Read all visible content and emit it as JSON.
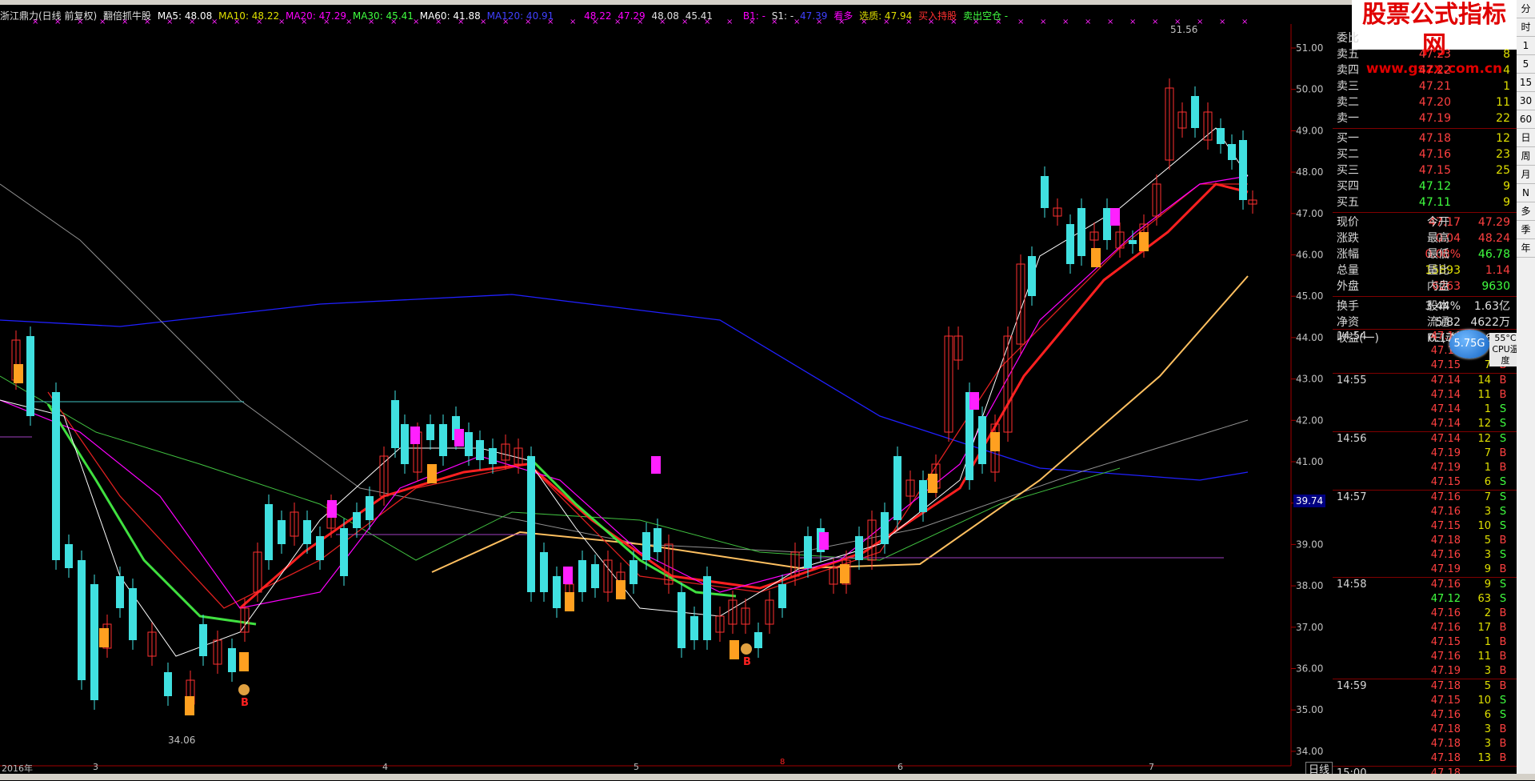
{
  "legend": {
    "title": "浙江鼎力(日线 前复权)",
    "formula": "翻倍抓牛股",
    "ma5": "MA5: 48.08",
    "ma10": "MA10: 48.22",
    "ma20": "MA20: 47.29",
    "ma30": "MA30: 45.41",
    "ma60": "MA60: 41.88",
    "ma120": "MA120: 40.91",
    "v1": "48.22",
    "v2": "47.29",
    "v3": "48.08",
    "v4": "45.41",
    "b1": "B1: -",
    "s1": "S1: -",
    "s1val": "47.39",
    "duo": "看多",
    "xuanq": "选质: 47.94",
    "buy": "买入持股",
    "sell": "卖出空仓 -"
  },
  "axis": {
    "labels": [
      "51.00",
      "50.00",
      "49.00",
      "48.00",
      "47.00",
      "46.00",
      "45.00",
      "44.00",
      "43.00",
      "42.00",
      "41.00",
      "40.00",
      "39.00",
      "38.00",
      "37.00",
      "36.00",
      "35.00",
      "34.00"
    ],
    "current": "39.74",
    "high": "51.56",
    "low": "34.06",
    "months": [
      "2016年",
      "3",
      "4",
      "5",
      "6",
      "7"
    ],
    "b_label": "B",
    "period": "日线"
  },
  "order_book": {
    "header": "委比",
    "asks": [
      {
        "label": "卖五",
        "price": "47.23",
        "vol": "8"
      },
      {
        "label": "卖四",
        "price": "47.22",
        "vol": "4"
      },
      {
        "label": "卖三",
        "price": "47.21",
        "vol": "1"
      },
      {
        "label": "卖二",
        "price": "47.20",
        "vol": "11"
      },
      {
        "label": "卖一",
        "price": "47.19",
        "vol": "22"
      }
    ],
    "bids": [
      {
        "label": "买一",
        "price": "47.18",
        "vol": "12"
      },
      {
        "label": "买二",
        "price": "47.16",
        "vol": "23"
      },
      {
        "label": "买三",
        "price": "47.15",
        "vol": "25"
      },
      {
        "label": "买四",
        "price": "47.12",
        "vol": "9"
      },
      {
        "label": "买五",
        "price": "47.11",
        "vol": "9"
      }
    ]
  },
  "quote": [
    {
      "k1": "现价",
      "v1": "47.17",
      "c1": "#ff4040",
      "k2": "今开",
      "v2": "47.29",
      "c2": "#ff4040"
    },
    {
      "k1": "涨跌",
      "v1": "0.04",
      "c1": "#ff4040",
      "k2": "最高",
      "v2": "48.24",
      "c2": "#ff4040"
    },
    {
      "k1": "涨幅",
      "v1": "0.08%",
      "c1": "#ff4040",
      "k2": "最低",
      "v2": "46.78",
      "c2": "#40ff40"
    },
    {
      "k1": "总量",
      "v1": "15893",
      "c1": "#e0e000",
      "k2": "量比",
      "v2": "1.14",
      "c2": "#ff4040"
    },
    {
      "k1": "外盘",
      "v1": "6263",
      "c1": "#ff4040",
      "k2": "内盘",
      "v2": "9630",
      "c2": "#40ff40"
    },
    {
      "k1": "换手",
      "v1": "3.44%",
      "c1": "#e0e0e0",
      "k2": "股本",
      "v2": "1.63亿",
      "c2": "#e0e0e0"
    },
    {
      "k1": "净资",
      "v1": "5.82",
      "c1": "#e0e0e0",
      "k2": "流通",
      "v2": "4622万",
      "c2": "#e0e0e0"
    },
    {
      "k1": "收益(一)",
      "v1": "0.177",
      "c1": "#e0e0e0",
      "k2": "PE(动)",
      "v2": "66.5",
      "c2": "#e0e0e0"
    }
  ],
  "ticks": [
    {
      "t": "14:54",
      "p": "47.14",
      "v": "",
      "d": ""
    },
    {
      "t": "",
      "p": "47.14",
      "v": "",
      "d": ""
    },
    {
      "t": "",
      "p": "47.15",
      "v": "7",
      "d": "B"
    },
    {
      "t": "14:55",
      "p": "47.14",
      "v": "14",
      "d": "B"
    },
    {
      "t": "",
      "p": "47.14",
      "v": "11",
      "d": "B"
    },
    {
      "t": "",
      "p": "47.14",
      "v": "1",
      "d": "S"
    },
    {
      "t": "",
      "p": "47.14",
      "v": "12",
      "d": "S"
    },
    {
      "t": "14:56",
      "p": "47.14",
      "v": "12",
      "d": "S"
    },
    {
      "t": "",
      "p": "47.19",
      "v": "7",
      "d": "B"
    },
    {
      "t": "",
      "p": "47.19",
      "v": "1",
      "d": "B"
    },
    {
      "t": "",
      "p": "47.15",
      "v": "6",
      "d": "S"
    },
    {
      "t": "14:57",
      "p": "47.16",
      "v": "7",
      "d": "S"
    },
    {
      "t": "",
      "p": "47.16",
      "v": "3",
      "d": "S"
    },
    {
      "t": "",
      "p": "47.15",
      "v": "10",
      "d": "S"
    },
    {
      "t": "",
      "p": "47.18",
      "v": "5",
      "d": "B"
    },
    {
      "t": "",
      "p": "47.16",
      "v": "3",
      "d": "S"
    },
    {
      "t": "",
      "p": "47.19",
      "v": "9",
      "d": "B"
    },
    {
      "t": "14:58",
      "p": "47.16",
      "v": "9",
      "d": "S"
    },
    {
      "t": "",
      "p": "47.12",
      "v": "63",
      "d": "S"
    },
    {
      "t": "",
      "p": "47.16",
      "v": "2",
      "d": "B"
    },
    {
      "t": "",
      "p": "47.16",
      "v": "17",
      "d": "B"
    },
    {
      "t": "",
      "p": "47.15",
      "v": "1",
      "d": "B"
    },
    {
      "t": "",
      "p": "47.16",
      "v": "11",
      "d": "B"
    },
    {
      "t": "",
      "p": "47.19",
      "v": "3",
      "d": "B"
    },
    {
      "t": "14:59",
      "p": "47.18",
      "v": "5",
      "d": "B"
    },
    {
      "t": "",
      "p": "47.15",
      "v": "10",
      "d": "S"
    },
    {
      "t": "",
      "p": "47.16",
      "v": "6",
      "d": "S"
    },
    {
      "t": "",
      "p": "47.18",
      "v": "3",
      "d": "B"
    },
    {
      "t": "",
      "p": "47.18",
      "v": "3",
      "d": "B"
    },
    {
      "t": "",
      "p": "47.18",
      "v": "13",
      "d": "B"
    },
    {
      "t": "15:00",
      "p": "47.18",
      "v": "",
      "d": ""
    }
  ],
  "sidetabs": [
    "分",
    "时",
    "1",
    "5",
    "15",
    "30",
    "60",
    "日",
    "周",
    "月",
    "N",
    "多",
    "季",
    "年"
  ],
  "badge": "5.75G",
  "cpu": [
    "55°C",
    "CPU温度"
  ],
  "watermark": [
    "股票公式指标网",
    "www.gszx.com.cn"
  ],
  "colors": {
    "up": "#ff3030",
    "down": "#40e0e0",
    "ma5": "#ffffff",
    "ma10": "#e0e000",
    "ma20": "#ff00ff",
    "ma30": "#40ff40",
    "ma60": "#808080",
    "ma120": "#2020ff"
  }
}
